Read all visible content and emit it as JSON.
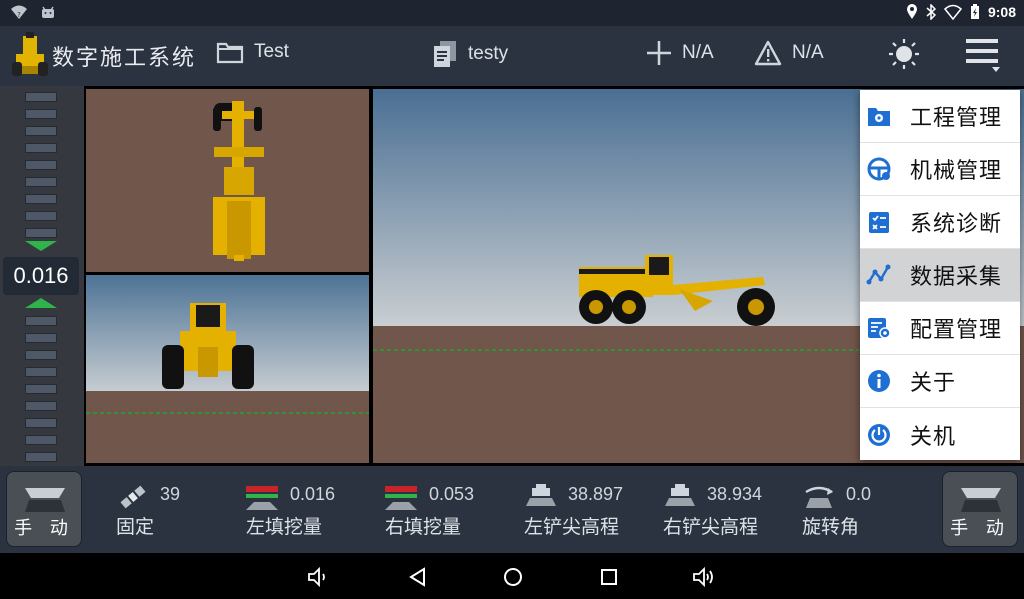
{
  "status_bar": {
    "time": "9:08"
  },
  "header": {
    "app_title": "数字施工系统",
    "project_name": "Test",
    "file_name": "testy",
    "precision_value": "N/A",
    "warning_value": "N/A"
  },
  "ladder": {
    "value": "0.016"
  },
  "bottom": {
    "left_mode": "手 动",
    "right_mode": "手 动",
    "stats": [
      {
        "value": "39",
        "label": "固定"
      },
      {
        "value": "0.016",
        "label": "左填挖量"
      },
      {
        "value": "0.053",
        "label": "右填挖量"
      },
      {
        "value": "38.897",
        "label": "左铲尖高程"
      },
      {
        "value": "38.934",
        "label": "右铲尖高程"
      },
      {
        "value": "0.0",
        "label": "旋转角"
      }
    ]
  },
  "menu": {
    "items": [
      {
        "label": "工程管理"
      },
      {
        "label": "机械管理"
      },
      {
        "label": "系统诊断"
      },
      {
        "label": "数据采集"
      },
      {
        "label": "配置管理"
      },
      {
        "label": "关于"
      },
      {
        "label": "关机"
      }
    ]
  },
  "colors": {
    "accent": "#2fb34a",
    "menu_icon": "#1e6fd1",
    "header_bg": "#2b3340"
  }
}
